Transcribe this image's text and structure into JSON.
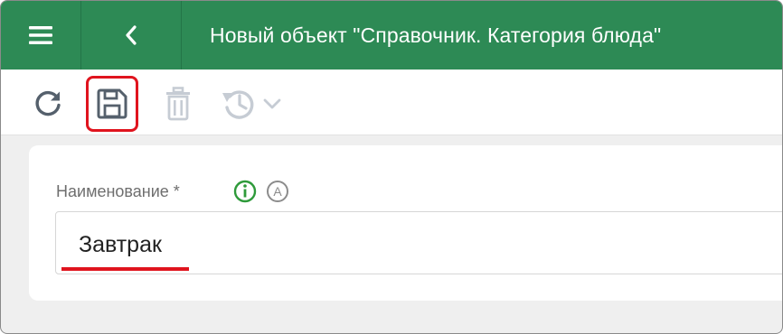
{
  "header": {
    "title": "Новый объект \"Справочник. Категория блюда\"",
    "menu_icon": "hamburger-menu-icon",
    "back_icon": "chevron-left-icon",
    "background_color": "#2d8a55"
  },
  "toolbar": {
    "buttons": [
      {
        "icon": "refresh-icon",
        "enabled": true
      },
      {
        "icon": "save-icon",
        "enabled": true,
        "highlighted": true
      },
      {
        "icon": "trash-icon",
        "enabled": false
      },
      {
        "icon": "history-icon",
        "enabled": false
      }
    ]
  },
  "form": {
    "name_label": "Наименование *",
    "name_value": "Завтрак",
    "info_icon": "info-icon",
    "auto_icon": "auto-fill-icon",
    "accent_color": "#e0141e"
  }
}
